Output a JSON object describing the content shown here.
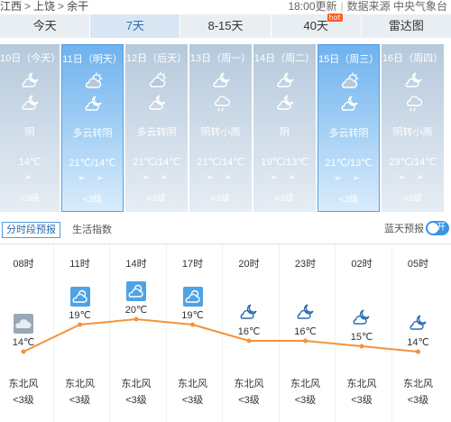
{
  "breadcrumb": [
    "江西",
    "上饶",
    "余干"
  ],
  "meta": {
    "updated": "18:00更新",
    "source": "数据来源 中央气象台"
  },
  "tabs": [
    {
      "label": "今天"
    },
    {
      "label": "7天"
    },
    {
      "label": "8-15天"
    },
    {
      "label": "40天"
    },
    {
      "label": "雷达图"
    }
  ],
  "hot_badge": "hot",
  "days": [
    {
      "date": "10日（今天）",
      "weather": "阴",
      "temp": "14℃",
      "arrows": "➢",
      "wind": "<3级",
      "icon1": "cloudy-night-icon",
      "icon2": "cloudy-night-icon"
    },
    {
      "date": "11日（明天）",
      "weather": "多云转阴",
      "temp": "21℃/14℃",
      "arrows": "➢ ➢",
      "wind": "<3级",
      "icon1": "partly-cloudy-icon",
      "icon2": "cloudy-night-icon"
    },
    {
      "date": "12日（后天）",
      "weather": "多云转阴",
      "temp": "21℃/14℃",
      "arrows": "➢ ➢",
      "wind": "<3级",
      "icon1": "partly-cloudy-icon",
      "icon2": "cloudy-night-icon"
    },
    {
      "date": "13日（周一）",
      "weather": "阴转小雨",
      "temp": "21℃/14℃",
      "arrows": "➢ ➢",
      "wind": "<3级",
      "icon1": "cloudy-night-icon",
      "icon2": "light-rain-icon"
    },
    {
      "date": "14日（周二）",
      "weather": "阴",
      "temp": "19℃/13℃",
      "arrows": "➢ ➢",
      "wind": "<3级",
      "icon1": "cloudy-night-icon",
      "icon2": "cloudy-night-icon"
    },
    {
      "date": "15日（周三）",
      "weather": "多云转阴",
      "temp": "21℃/13℃",
      "arrows": "➢ ➢",
      "wind": "<3级",
      "icon1": "partly-cloudy-icon",
      "icon2": "cloudy-night-icon"
    },
    {
      "date": "16日（周四）",
      "weather": "阴转小雨",
      "temp": "23℃/14℃",
      "arrows": "➢ ➢",
      "wind": "<3级",
      "icon1": "cloudy-night-icon",
      "icon2": "light-rain-icon"
    }
  ],
  "subtabs": {
    "period": "分时段预报",
    "life": "生活指数"
  },
  "sky": {
    "label": "蓝天预报",
    "toggle": "开"
  },
  "hourly": [
    {
      "time": "08时",
      "temp_text": "14℃",
      "temp": 14,
      "wind": "东北风",
      "level": "<3级",
      "icon": "overcast-icon"
    },
    {
      "time": "11时",
      "temp_text": "19℃",
      "temp": 19,
      "wind": "东北风",
      "level": "<3级",
      "icon": "partly-cloudy-icon"
    },
    {
      "time": "14时",
      "temp_text": "20℃",
      "temp": 20,
      "wind": "东北风",
      "level": "<3级",
      "icon": "partly-cloudy-icon"
    },
    {
      "time": "17时",
      "temp_text": "19℃",
      "temp": 19,
      "wind": "东北风",
      "level": "<3级",
      "icon": "partly-cloudy-icon"
    },
    {
      "time": "20时",
      "temp_text": "16℃",
      "temp": 16,
      "wind": "东北风",
      "level": "<3级",
      "icon": "cloudy-night-icon"
    },
    {
      "time": "23时",
      "temp_text": "16℃",
      "temp": 16,
      "wind": "东北风",
      "level": "<3级",
      "icon": "cloudy-night-icon"
    },
    {
      "time": "02时",
      "temp_text": "15℃",
      "temp": 15,
      "wind": "东北风",
      "level": "<3级",
      "icon": "cloudy-night-icon"
    },
    {
      "time": "05时",
      "temp_text": "14℃",
      "temp": 14,
      "wind": "东北风",
      "level": "<3级",
      "icon": "cloudy-night-icon"
    }
  ],
  "colors": {
    "accent": "#2a6db3",
    "curve": "#f5923a",
    "selected_day": "#6eb2ee",
    "day_card": "#b6c9dc"
  }
}
